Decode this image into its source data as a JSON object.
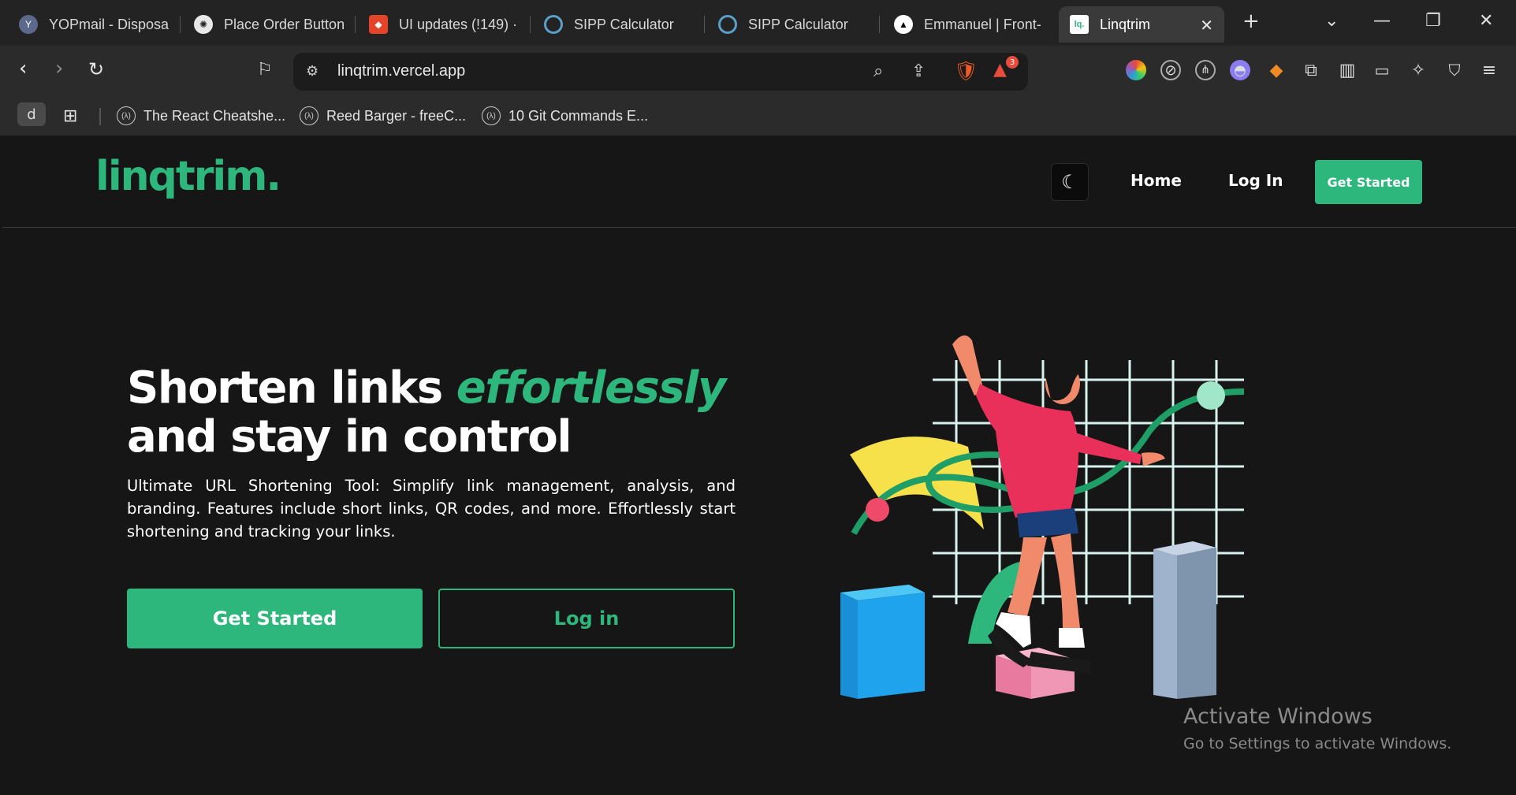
{
  "browser": {
    "tabs": [
      {
        "label": "YOPmail - Disposa",
        "icon": "yopmail-icon"
      },
      {
        "label": "Place Order Button",
        "icon": "openai-icon"
      },
      {
        "label": "UI updates (!149) ·",
        "icon": "gitlab-icon"
      },
      {
        "label": "SIPP Calculator",
        "icon": "circle-icon"
      },
      {
        "label": "SIPP Calculator",
        "icon": "circle-icon"
      },
      {
        "label": "Emmanuel | Front-",
        "icon": "triangle-icon"
      },
      {
        "label": "Linqtrim",
        "icon": "linqtrim-icon",
        "active": true
      }
    ],
    "new_tab": "+",
    "url": "linqtrim.vercel.app",
    "brave_badge": "3",
    "profile": "d",
    "bookmarks": [
      {
        "label": "The React Cheatshe..."
      },
      {
        "label": "Reed Barger - freeC..."
      },
      {
        "label": "10 Git Commands E..."
      }
    ]
  },
  "site": {
    "logo": "linqtrim.",
    "nav": {
      "home": "Home",
      "login": "Log In",
      "cta": "Get Started"
    },
    "hero": {
      "title_part1": "Shorten links ",
      "title_accent": "effortlessly",
      "title_line2": "and stay in control",
      "description": "Ultimate URL Shortening Tool: Simplify link management, analysis, and branding. Features include short links, QR codes, and more. Effortlessly start shortening and tracking your links.",
      "primary_button": "Get Started",
      "secondary_button": "Log in"
    },
    "colors": {
      "accent": "#2eb77c",
      "background": "#161616"
    }
  },
  "os_overlay": {
    "title": "Activate Windows",
    "subtitle": "Go to Settings to activate Windows."
  }
}
